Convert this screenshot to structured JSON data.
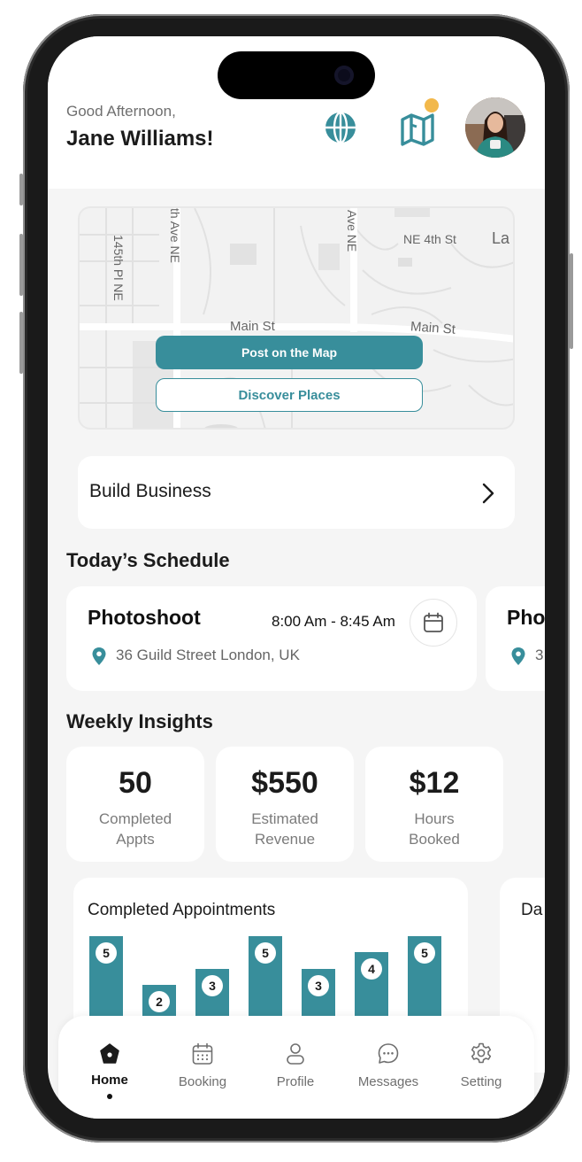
{
  "header": {
    "greeting": "Good Afternoon,",
    "user_name": "Jane Williams!",
    "icons": [
      "globe-icon",
      "map-icon",
      "notification-dot",
      "avatar"
    ]
  },
  "map": {
    "labels": {
      "street_145th_pl": "145th Pl NE",
      "street_th_ave_left": "th Ave NE",
      "street_ave_right": "Ave NE",
      "street_ne_4th": "NE 4th St",
      "street_la": "La",
      "street_main_left": "Main St",
      "street_main_right": "Main St"
    },
    "post_button": "Post on the Map",
    "discover_button": "Discover Places"
  },
  "build_business": {
    "label": "Build Business"
  },
  "schedule": {
    "title": "Today’s Schedule",
    "items": [
      {
        "title": "Photoshoot",
        "time": "8:00 Am - 8:45 Am",
        "location": "36 Guild Street London, UK"
      },
      {
        "title": "Pho",
        "location": "3"
      }
    ]
  },
  "insights": {
    "title": "Weekly Insights",
    "cards": [
      {
        "value": "50",
        "label_line1": "Completed",
        "label_line2": "Appts"
      },
      {
        "value": "$550",
        "label_line1": "Estimated",
        "label_line2": "Revenue"
      },
      {
        "value": "$12",
        "label_line1": "Hours",
        "label_line2": "Booked"
      }
    ]
  },
  "chart_data": {
    "type": "bar",
    "title": "Completed Appointments",
    "values": [
      5,
      2,
      3,
      5,
      3,
      4,
      5
    ],
    "ylim": [
      0,
      5
    ]
  },
  "chart_peek": {
    "title": "Da"
  },
  "tabbar": {
    "tabs": [
      {
        "label": "Home",
        "icon": "home-icon",
        "active": true
      },
      {
        "label": "Booking",
        "icon": "calendar-icon",
        "active": false
      },
      {
        "label": "Profile",
        "icon": "profile-icon",
        "active": false
      },
      {
        "label": "Messages",
        "icon": "chat-icon",
        "active": false
      },
      {
        "label": "Setting",
        "icon": "gear-icon",
        "active": false
      }
    ]
  },
  "colors": {
    "accent": "#388e9b",
    "badge": "#f2b84b",
    "background": "#f5f5f5"
  }
}
